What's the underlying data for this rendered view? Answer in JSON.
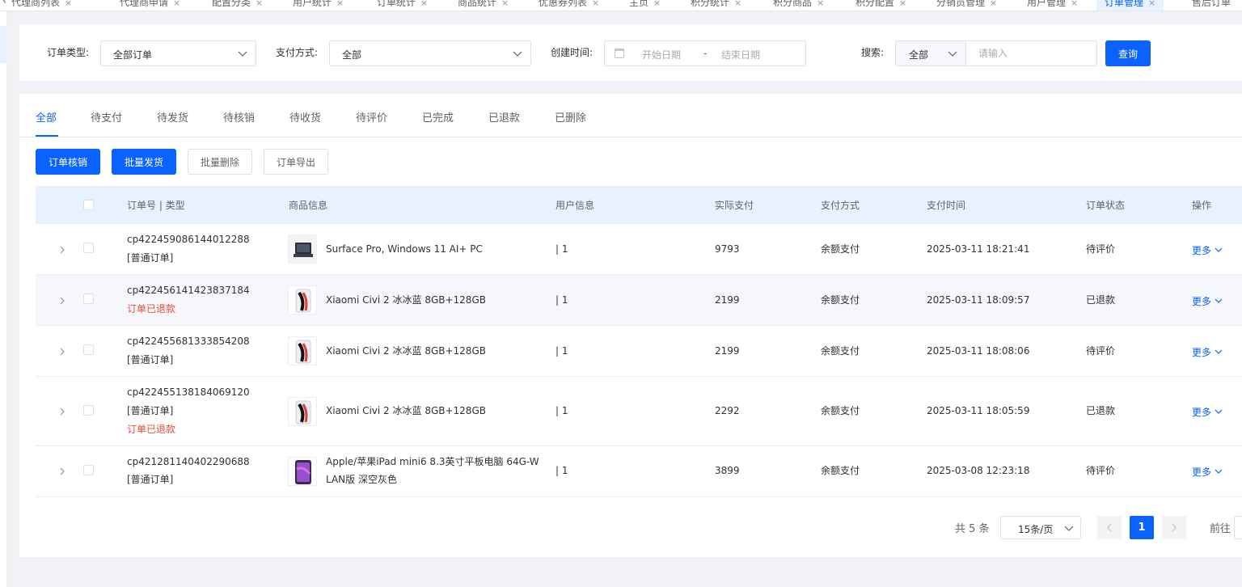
{
  "tabbar": {
    "tabs": [
      {
        "label": "代理商列表",
        "active": false
      },
      {
        "label": "代理商申请",
        "active": false
      },
      {
        "label": "配置分类",
        "active": false
      },
      {
        "label": "用户统计",
        "active": false
      },
      {
        "label": "订单统计",
        "active": false
      },
      {
        "label": "商品统计",
        "active": false
      },
      {
        "label": "优惠券列表",
        "active": false
      },
      {
        "label": "主页",
        "active": false
      },
      {
        "label": "积分统计",
        "active": false
      },
      {
        "label": "积分商品",
        "active": false
      },
      {
        "label": "积分配置",
        "active": false
      },
      {
        "label": "分销员管理",
        "active": false
      },
      {
        "label": "用户管理",
        "active": false
      },
      {
        "label": "订单管理",
        "active": true
      },
      {
        "label": "售后订单",
        "active": false
      }
    ],
    "close_glyph": "×",
    "left_arrow": "‹"
  },
  "filter": {
    "order_type_label": "订单类型:",
    "order_type_value": "全部订单",
    "pay_method_label": "支付方式:",
    "pay_method_value": "全部",
    "created_label": "创建时间:",
    "start_placeholder": "开始日期",
    "date_sep": "-",
    "end_placeholder": "结束日期",
    "search_label": "搜索:",
    "search_scope": "全部",
    "search_placeholder": "请输入",
    "query_button": "查询"
  },
  "status_tabs": [
    {
      "label": "全部",
      "active": true
    },
    {
      "label": "待支付"
    },
    {
      "label": "待发货"
    },
    {
      "label": "待核销"
    },
    {
      "label": "待收货"
    },
    {
      "label": "待评价"
    },
    {
      "label": "已完成"
    },
    {
      "label": "已退款"
    },
    {
      "label": "已删除"
    }
  ],
  "actions": {
    "verify": "订单核销",
    "batch_ship": "批量发货",
    "batch_delete": "批量删除",
    "export": "订单导出"
  },
  "table": {
    "headers": {
      "order_no": "订单号 | 类型",
      "product": "商品信息",
      "user": "用户信息",
      "paid": "实际支付",
      "method": "支付方式",
      "time": "支付时间",
      "status": "订单状态",
      "op": "操作"
    },
    "rows": [
      {
        "order_no": "cp422459086144012288",
        "type": "[普通订单]",
        "refund_note": "",
        "product": "Surface Pro, Windows 11 AI+ PC",
        "product2": "",
        "thumb": "laptop",
        "user": "| 1",
        "paid": "9793",
        "method": "余额支付",
        "time": "2025-03-11 18:21:41",
        "status": "待评价",
        "op": "更多"
      },
      {
        "order_no": "cp422456141423837184",
        "type": "",
        "refund_note": "订单已退款",
        "product": "Xiaomi Civi 2 冰冰蓝 8GB+128GB",
        "product2": "",
        "thumb": "phone",
        "user": "| 1",
        "paid": "2199",
        "method": "余额支付",
        "time": "2025-03-11 18:09:57",
        "status": "已退款",
        "op": "更多"
      },
      {
        "order_no": "cp422455681333854208",
        "type": "[普通订单]",
        "refund_note": "",
        "product": "Xiaomi Civi 2 冰冰蓝 8GB+128GB",
        "product2": "",
        "thumb": "phone",
        "user": "| 1",
        "paid": "2199",
        "method": "余额支付",
        "time": "2025-03-11 18:08:06",
        "status": "待评价",
        "op": "更多"
      },
      {
        "order_no": "cp422455138184069120",
        "type": "[普通订单]",
        "refund_note": "订单已退款",
        "product": "Xiaomi Civi 2 冰冰蓝 8GB+128GB",
        "product2": "",
        "thumb": "phone",
        "user": "| 1",
        "paid": "2292",
        "method": "余额支付",
        "time": "2025-03-11 18:05:59",
        "status": "已退款",
        "op": "更多"
      },
      {
        "order_no": "cp421281140402290688",
        "type": "[普通订单]",
        "refund_note": "",
        "product": "Apple/苹果iPad mini6 8.3英寸平板电脑 64G-W",
        "product2": "LAN版 深空灰色",
        "thumb": "tablet",
        "user": "| 1",
        "paid": "3899",
        "method": "余额支付",
        "time": "2025-03-08 12:23:18",
        "status": "待评价",
        "op": "更多"
      }
    ]
  },
  "pagination": {
    "total": "共 5 条",
    "page_size": "15条/页",
    "current_page": "1",
    "goto": "前往"
  },
  "colors": {
    "primary": "#0a62ff",
    "danger": "#f04c3b",
    "header_bg": "#e8f1ff",
    "stripe": "#f5f7fa"
  }
}
